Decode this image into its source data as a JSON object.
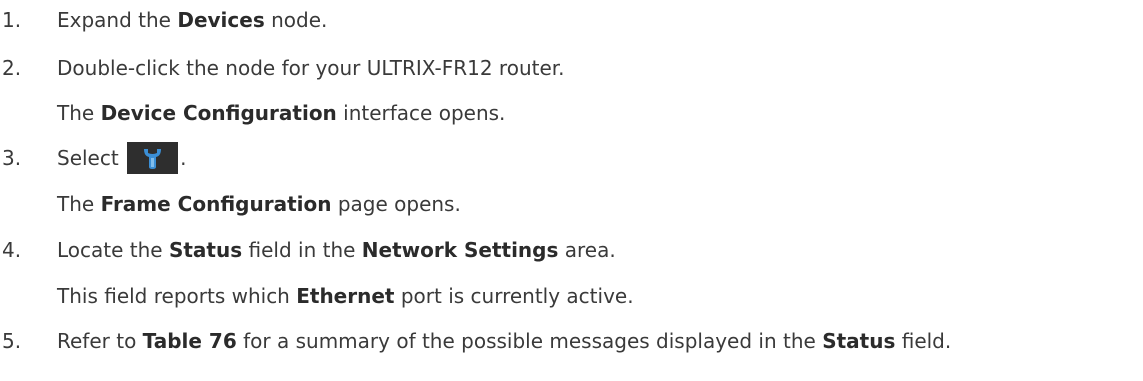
{
  "steps": [
    {
      "number": "1.",
      "lines": [
        {
          "parts": [
            {
              "t": "Expand the "
            },
            {
              "t": "Devices",
              "b": true
            },
            {
              "t": " node."
            }
          ]
        }
      ]
    },
    {
      "number": "2.",
      "lines": [
        {
          "parts": [
            {
              "t": "Double-click the node for your ULTRIX-FR12 router."
            }
          ]
        },
        {
          "parts": [
            {
              "t": "The "
            },
            {
              "t": "Device Configuration",
              "b": true
            },
            {
              "t": " interface opens."
            }
          ]
        }
      ]
    },
    {
      "number": "3.",
      "lines": [
        {
          "parts": [
            {
              "t": "Select "
            },
            {
              "icon": "wrench-config-icon"
            },
            {
              "t": "."
            }
          ]
        },
        {
          "parts": [
            {
              "t": "The "
            },
            {
              "t": "Frame Configuration",
              "b": true
            },
            {
              "t": " page opens."
            }
          ]
        }
      ]
    },
    {
      "number": "4.",
      "lines": [
        {
          "parts": [
            {
              "t": "Locate the "
            },
            {
              "t": "Status",
              "b": true
            },
            {
              "t": " field in the "
            },
            {
              "t": "Network Settings",
              "b": true
            },
            {
              "t": " area."
            }
          ]
        },
        {
          "parts": [
            {
              "t": "This field reports which "
            },
            {
              "t": "Ethernet",
              "b": true
            },
            {
              "t": " port is currently active."
            }
          ]
        }
      ]
    },
    {
      "number": "5.",
      "lines": [
        {
          "parts": [
            {
              "t": "Refer to "
            },
            {
              "t": "Table 76",
              "b": true
            },
            {
              "t": " for a summary of the possible messages displayed in the "
            },
            {
              "t": "Status",
              "b": true
            },
            {
              "t": " field."
            }
          ]
        }
      ]
    }
  ],
  "colors": {
    "text": "#3a3a3a",
    "icon_background": "#2e2e2e",
    "icon_glyph": "#3b8fd6"
  }
}
